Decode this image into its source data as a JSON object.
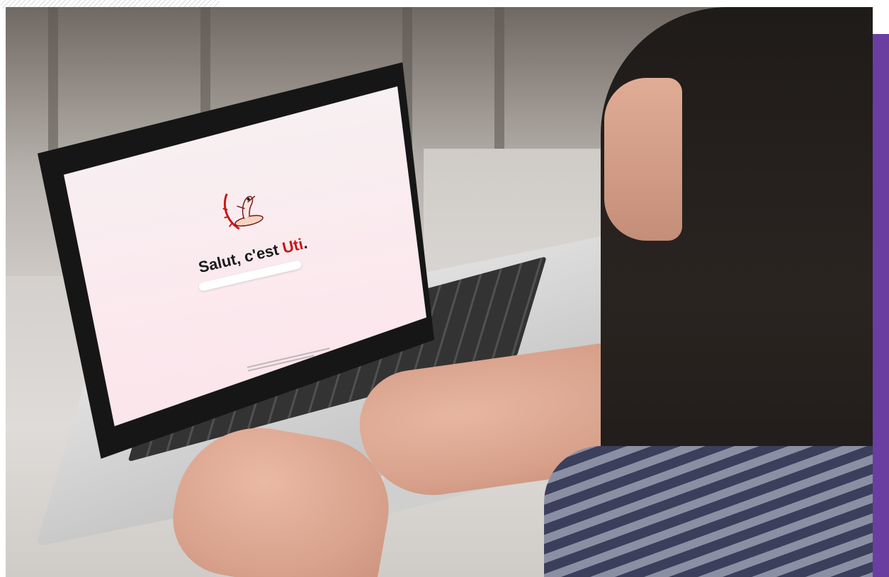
{
  "screen": {
    "headline_prefix": "Salut, c'est ",
    "headline_accent": "Uti",
    "headline_suffix": ".",
    "accent_color": "#c81818",
    "mascot_icon": "surfing-mascot-icon"
  },
  "frame": {
    "side_bar_color": "#6a3ea1"
  }
}
